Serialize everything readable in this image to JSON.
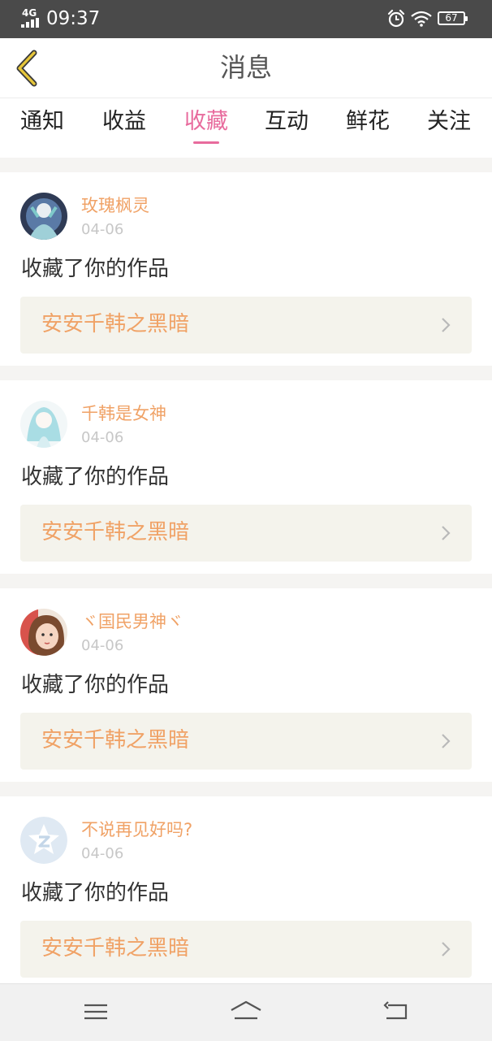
{
  "status_bar": {
    "network": "4G",
    "time": "09:37",
    "battery": "67",
    "icons": [
      "signal-icon",
      "alarm-icon",
      "wifi-icon",
      "battery-icon"
    ]
  },
  "header": {
    "title": "消息",
    "back_icon": "chevron-left-icon",
    "back_color": "#c9a70b"
  },
  "tabs": [
    {
      "label": "通知",
      "active": false
    },
    {
      "label": "收益",
      "active": false
    },
    {
      "label": "收藏",
      "active": true
    },
    {
      "label": "互动",
      "active": false
    },
    {
      "label": "鲜花",
      "active": false
    },
    {
      "label": "关注",
      "active": false
    }
  ],
  "accent_color": "#e86b9d",
  "name_color": "#f0a266",
  "items": [
    {
      "user": "玫瑰枫灵",
      "date": "04-06",
      "action": "收藏了你的作品",
      "work": "安安千韩之黑暗"
    },
    {
      "user": "千韩是女神",
      "date": "04-06",
      "action": "收藏了你的作品",
      "work": "安安千韩之黑暗"
    },
    {
      "user": "ヾ国民男神ヾ",
      "date": "04-06",
      "action": "收藏了你的作品",
      "work": "安安千韩之黑暗"
    },
    {
      "user": "不说再见好吗?",
      "date": "04-06",
      "action": "收藏了你的作品",
      "work": "安安千韩之黑暗"
    }
  ],
  "nav_bar": {
    "icons": [
      "menu-icon",
      "home-icon",
      "back-icon"
    ]
  }
}
